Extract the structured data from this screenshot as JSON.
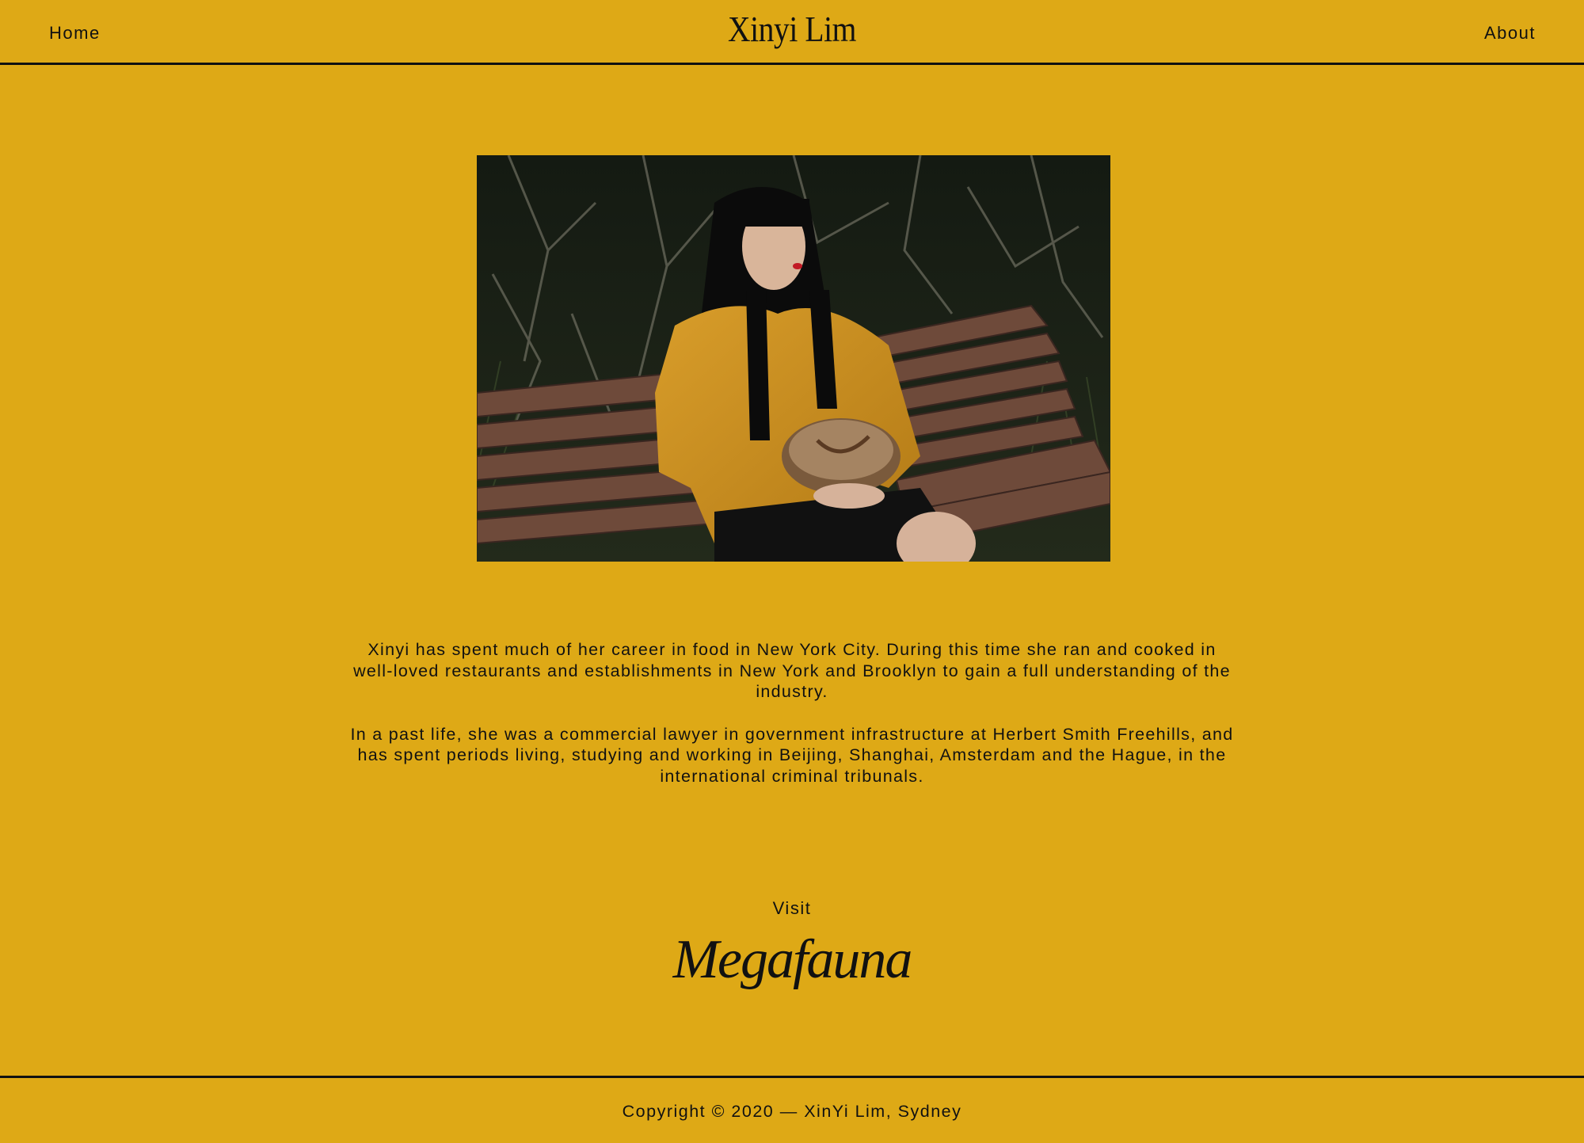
{
  "header": {
    "home_label": "Home",
    "brand": "Xinyi Lim",
    "about_label": "About"
  },
  "main": {
    "bio": [
      "Xinyi has spent much of her career in food in New York City. During this time she ran and cooked in well-loved restaurants and establishments in New York and Brooklyn to gain a full understanding of the industry.",
      "In a past life, she was a commercial lawyer in government infrastructure at Herbert Smith Freehills, and has spent periods living, studying and working in Beijing, Shanghai, Amsterdam and the Hague, in the international criminal tribunals."
    ],
    "visit_label": "Visit",
    "megafauna_link": "Megafauna"
  },
  "footer": {
    "copyright": "Copyright © 2020 — XinYi Lim, Sydney"
  },
  "colors": {
    "background": "#dea916",
    "text": "#111111"
  }
}
